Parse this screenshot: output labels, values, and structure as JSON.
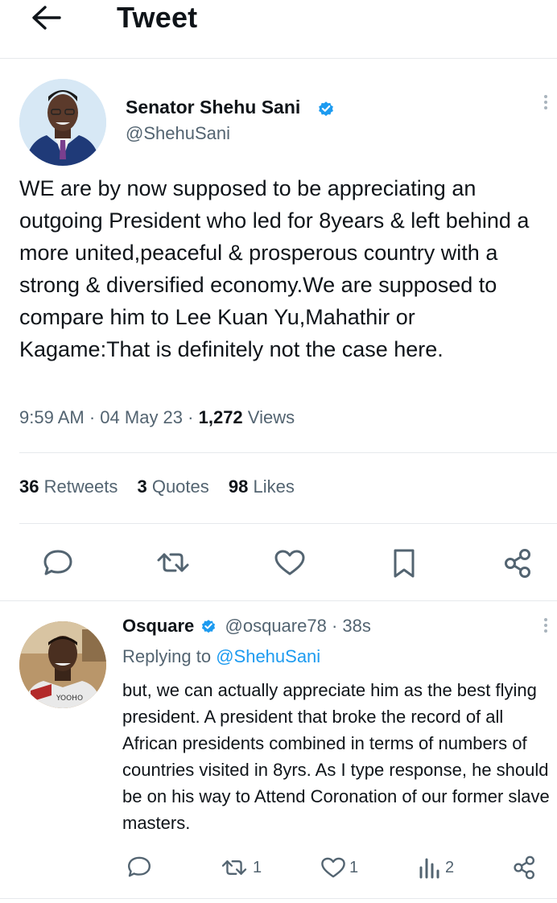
{
  "header": {
    "title": "Tweet",
    "back_icon": "arrow-left-icon"
  },
  "tweet": {
    "author_name": "Senator Shehu Sani",
    "author_handle": "@ShehuSani",
    "verified_color": "#1d9bf0",
    "text": "WE are by now supposed to be appreciating an outgoing President who led for 8years & left behind a more united,peaceful & prosperous country with a strong & diversified economy.We are supposed to compare him to Lee Kuan Yu,Mahathir or Kagame:That is definitely not the case here.",
    "time": "9:59 AM",
    "date": "04 May 23",
    "views_count": "1,272",
    "views_label": "Views",
    "retweets_count": "36",
    "retweets_label": "Retweets",
    "quotes_count": "3",
    "quotes_label": "Quotes",
    "likes_count": "98",
    "likes_label": "Likes",
    "actions": [
      "reply-icon",
      "retweet-icon",
      "like-icon",
      "bookmark-icon",
      "share-icon"
    ]
  },
  "reply": {
    "author_name": "Osquare",
    "author_handle": "@osquare78",
    "time": "38s",
    "replying_label": "Replying to",
    "replying_handle": "@ShehuSani",
    "text": "but, we can actually appreciate him as the best flying president. A president that broke the record of all African presidents combined in terms of numbers of countries visited in 8yrs. As I type response, he should be on his way to Attend Coronation of our former slave masters.",
    "retweets": "1",
    "likes": "1",
    "views": "2"
  },
  "colors": {
    "text": "#0f1419",
    "secondary": "#536471",
    "accent": "#1d9bf0",
    "divider": "#e6e9ec"
  }
}
